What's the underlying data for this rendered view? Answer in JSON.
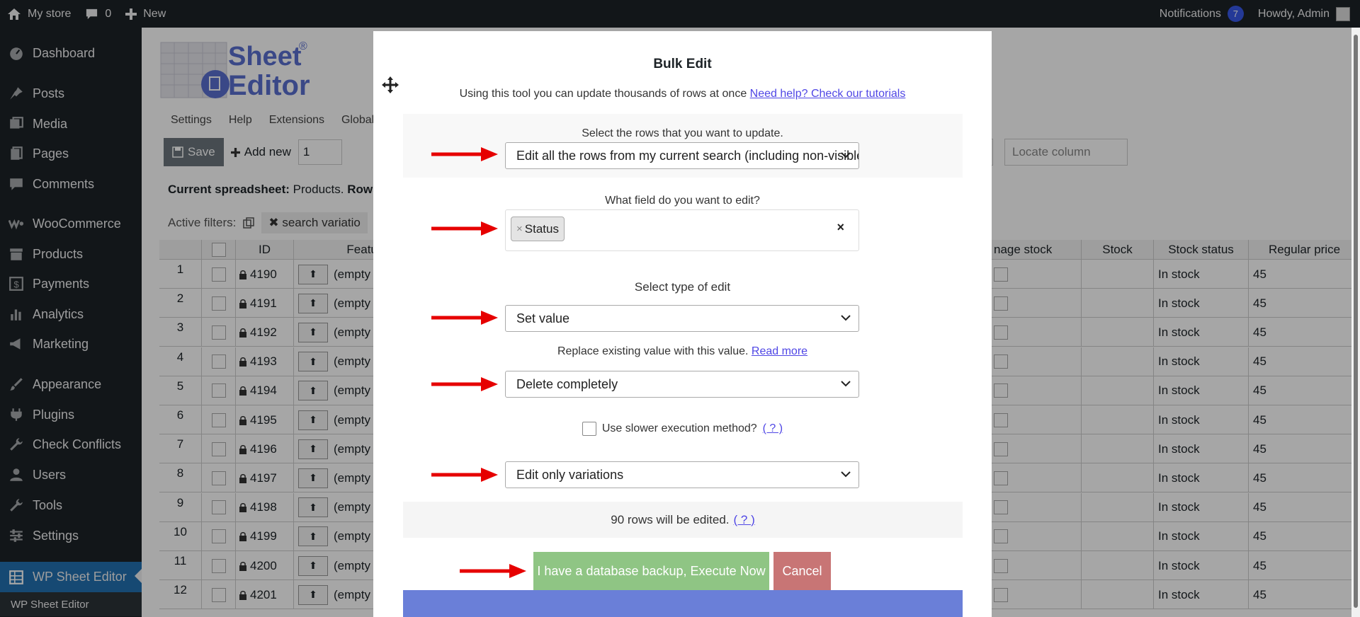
{
  "adminbar": {
    "site_name": "My store",
    "comments_count": "0",
    "new_label": "New",
    "notifications_label": "Notifications",
    "notifications_count": "7",
    "howdy": "Howdy, Admin"
  },
  "menu": {
    "items": [
      {
        "label": "Dashboard",
        "icon": "dashboard-icon"
      },
      {
        "label": "Posts",
        "icon": "pin-icon"
      },
      {
        "label": "Media",
        "icon": "media-icon"
      },
      {
        "label": "Pages",
        "icon": "pages-icon"
      },
      {
        "label": "Comments",
        "icon": "comment-icon"
      },
      {
        "label": "WooCommerce",
        "icon": "woocommerce-icon"
      },
      {
        "label": "Products",
        "icon": "archive-icon"
      },
      {
        "label": "Payments",
        "icon": "dollar-icon"
      },
      {
        "label": "Analytics",
        "icon": "bar-chart-icon"
      },
      {
        "label": "Marketing",
        "icon": "megaphone-icon"
      },
      {
        "label": "Appearance",
        "icon": "paintbrush-icon"
      },
      {
        "label": "Plugins",
        "icon": "plugin-icon"
      },
      {
        "label": "Check Conflicts",
        "icon": "wrench-icon"
      },
      {
        "label": "Users",
        "icon": "user-icon"
      },
      {
        "label": "Tools",
        "icon": "tools-icon"
      },
      {
        "label": "Settings",
        "icon": "settings-icon"
      },
      {
        "label": "WP Sheet Editor",
        "icon": "sheet-icon"
      }
    ],
    "submenu_label": "WP Sheet Editor"
  },
  "background": {
    "logo_text_top": "Sheet",
    "logo_text_bottom": "Editor",
    "logo_reg": "®",
    "topnav": [
      "Settings",
      "Help",
      "Extensions",
      "Global s"
    ],
    "save_label": "Save",
    "add_new_label": "Add new",
    "add_new_count": "1",
    "locate_placeholder": "Locate column",
    "current_sheet_label": "Current spreadsheet:",
    "current_sheet_value": "Products.",
    "rows_label": "Rows",
    "active_filters_label": "Active filters:",
    "filter_chip": "search variatio",
    "columns": {
      "id": "ID",
      "featured": "Feature",
      "manage_stock": "nage stock",
      "stock": "Stock",
      "stock_status": "Stock status",
      "regular_price": "Regular price"
    },
    "rows": [
      {
        "n": "1",
        "id": "4190",
        "featured": "(empty",
        "status": "In stock",
        "price": "45"
      },
      {
        "n": "2",
        "id": "4191",
        "featured": "(empty",
        "status": "In stock",
        "price": "45"
      },
      {
        "n": "3",
        "id": "4192",
        "featured": "(empty",
        "status": "In stock",
        "price": "45"
      },
      {
        "n": "4",
        "id": "4193",
        "featured": "(empty",
        "status": "In stock",
        "price": "45"
      },
      {
        "n": "5",
        "id": "4194",
        "featured": "(empty",
        "status": "In stock",
        "price": "45"
      },
      {
        "n": "6",
        "id": "4195",
        "featured": "(empty",
        "status": "In stock",
        "price": "45"
      },
      {
        "n": "7",
        "id": "4196",
        "featured": "(empty",
        "status": "In stock",
        "price": "45"
      },
      {
        "n": "8",
        "id": "4197",
        "featured": "(empty",
        "status": "In stock",
        "price": "45"
      },
      {
        "n": "9",
        "id": "4198",
        "featured": "(empty",
        "status": "In stock",
        "price": "45"
      },
      {
        "n": "10",
        "id": "4199",
        "featured": "(empty",
        "status": "In stock",
        "price": "45"
      },
      {
        "n": "11",
        "id": "4200",
        "featured": "(empty",
        "status": "In stock",
        "price": "45"
      },
      {
        "n": "12",
        "id": "4201",
        "featured": "(empty",
        "status": "In stock",
        "price": "45"
      }
    ]
  },
  "modal": {
    "title": "Bulk Edit",
    "intro_text": "Using this tool you can update thousands of rows at once",
    "intro_link": "Need help? Check our tutorials",
    "rows_label": "Select the rows that you want to update.",
    "rows_value": "Edit all the rows from my current search (including non-visible rows).",
    "field_label": "What field do you want to edit?",
    "field_tag": "Status",
    "field_tag_remove": "×",
    "field_clear": "×",
    "edit_type_label": "Select type of edit",
    "edit_type_value": "Set value",
    "replace_text": "Replace existing value with this value.",
    "read_more": "Read more",
    "value_select": "Delete completely",
    "slower_label": "Use slower execution method?",
    "help_link": "( ? )",
    "variations_select": "Edit only variations",
    "rows_count_text": "90 rows will be edited.",
    "rows_count_help": "( ? )",
    "execute_label": "I have a database backup, Execute Now",
    "cancel_label": "Cancel"
  },
  "colors": {
    "execute_button": "#8fc584",
    "cancel_button": "#c87575",
    "arrow": "#e60000",
    "link": "#4f46e5"
  }
}
